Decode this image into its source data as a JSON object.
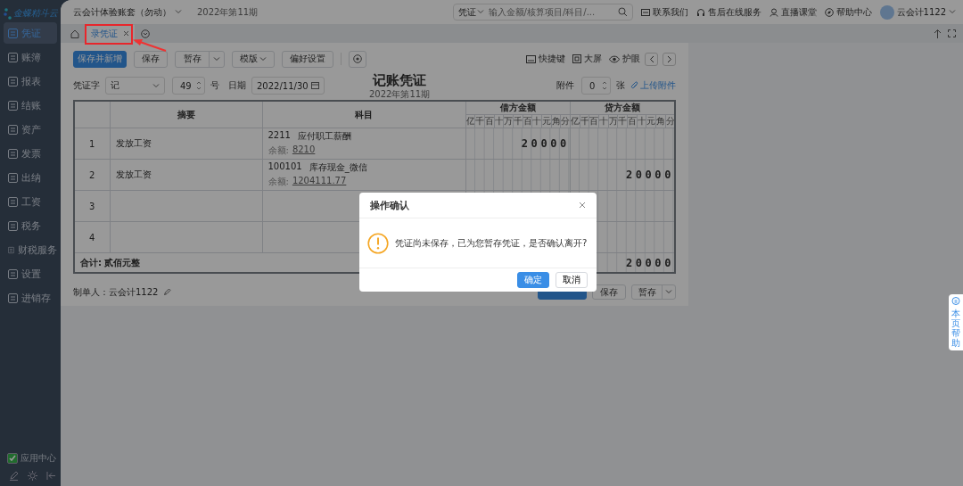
{
  "sidebar": {
    "logo": "金蝶精斗云",
    "items": [
      {
        "label": "凭证",
        "selected": true
      },
      {
        "label": "账簿",
        "selected": false
      },
      {
        "label": "报表",
        "selected": false
      },
      {
        "label": "结账",
        "selected": false
      },
      {
        "label": "资产",
        "selected": false
      },
      {
        "label": "发票",
        "selected": false
      },
      {
        "label": "出纳",
        "selected": false
      },
      {
        "label": "工资",
        "selected": false
      },
      {
        "label": "税务",
        "selected": false
      },
      {
        "label": "财税服务",
        "selected": false
      },
      {
        "label": "设置",
        "selected": false
      },
      {
        "label": "进销存",
        "selected": false
      }
    ],
    "app_center": {
      "label": "应用中心",
      "checked": true
    }
  },
  "header": {
    "account": "云会计体验账套（勿动）",
    "period": "2022年第11期",
    "search": {
      "scope": "凭证",
      "placeholder": "输入金额/核算项目/科目/..."
    },
    "links": [
      {
        "label": "联系我们",
        "kind": "contact"
      },
      {
        "label": "售后在线服务",
        "kind": "service"
      },
      {
        "label": "直播课堂",
        "kind": "live"
      },
      {
        "label": "帮助中心",
        "kind": "help"
      }
    ],
    "user": "云会计1122"
  },
  "tabs": [
    {
      "label": "录凭证",
      "selected": true
    }
  ],
  "toolbar": {
    "buttons": [
      {
        "label": "保存并新增",
        "kind": "primary"
      },
      {
        "label": "保存",
        "kind": "plain"
      },
      {
        "label": "暂存",
        "kind": "split"
      },
      {
        "label": "模版",
        "kind": "dropdown"
      },
      {
        "label": "偏好设置",
        "kind": "plain"
      },
      {
        "kind": "icon"
      }
    ],
    "tools": [
      {
        "label": "快捷键",
        "kind": "keyboard"
      },
      {
        "label": "大屏",
        "kind": "screen"
      },
      {
        "label": "护眼",
        "kind": "eye"
      }
    ]
  },
  "form": {
    "word_label": "凭证字",
    "word": "记",
    "number": "49",
    "number_suffix": "号",
    "date_label": "日期",
    "date": "2022/11/30",
    "title": "记账凭证",
    "period": "2022年第11期",
    "attach_label": "附件",
    "attach_count": "0",
    "attach_suffix": "张",
    "upload": "上传附件"
  },
  "table": {
    "columns": [
      "摘要",
      "科目",
      "借方金额",
      "贷方金额"
    ],
    "debit_units": [
      "亿",
      "千",
      "百",
      "十",
      "万",
      "千",
      "百",
      "十",
      "元",
      "角",
      "分"
    ],
    "credit_units": [
      "亿",
      "千",
      "百",
      "十",
      "万",
      "千",
      "百",
      "十",
      "元",
      "角",
      "分"
    ],
    "rows": [
      {
        "index": "1",
        "summary": "发放工资",
        "code": "2211",
        "account": "应付职工薪酬",
        "balance_label": "余额:",
        "balance": "8210",
        "debit": "20000"
      },
      {
        "index": "2",
        "summary": "发放工资",
        "code": "100101",
        "account": "库存现金_微信",
        "balance_label": "余额:",
        "balance": "1204111.77",
        "credit": "20000"
      },
      {
        "index": "3"
      },
      {
        "index": "4"
      }
    ],
    "total": {
      "label": "合计: 贰佰元整",
      "credit": "20000"
    }
  },
  "footer": {
    "maker": "制单人：云会计1122",
    "buttons": [
      {
        "kind": "primary"
      },
      {
        "label": "保存",
        "kind": "plain"
      },
      {
        "label": "暂存",
        "kind": "split"
      }
    ]
  },
  "dialog": {
    "title": "操作确认",
    "message": "凭证尚未保存，已为您暂存凭证，是否确认离开?",
    "buttons": [
      {
        "label": "确定",
        "kind": "primary"
      },
      {
        "label": "取消",
        "kind": "plain"
      }
    ]
  },
  "help_tab": "本页帮助"
}
